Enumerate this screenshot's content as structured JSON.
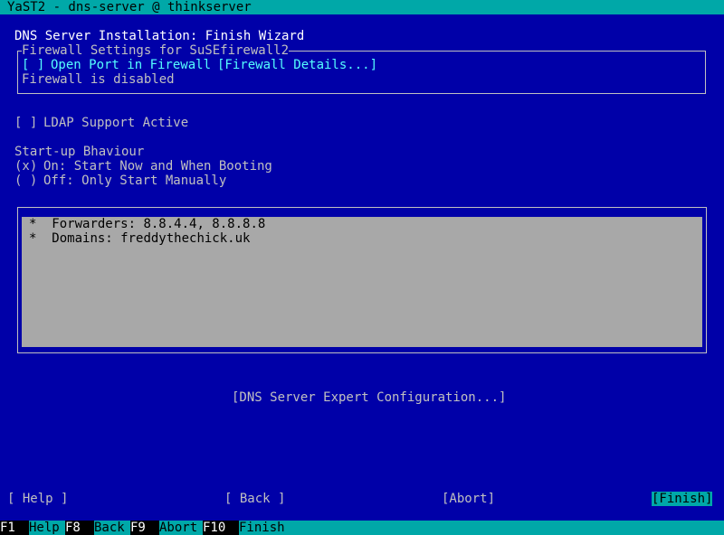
{
  "window": {
    "title": "YaST2 - dns-server @ thinkserver"
  },
  "dialog": {
    "heading": "DNS Server Installation: Finish Wizard"
  },
  "firewall": {
    "legend": "Firewall Settings for SuSEfirewall2",
    "open_port_checkbox": "[ ]",
    "open_port_label": "Open Port in Firewall",
    "details_button": "[Firewall Details...]",
    "status": "Firewall is disabled"
  },
  "ldap": {
    "checkbox": "[ ]",
    "label": "LDAP Support Active"
  },
  "startup": {
    "heading": "Start-up Bhaviour",
    "options": [
      {
        "radio": "(x)",
        "label": "On: Start Now and When Booting"
      },
      {
        "radio": "( )",
        "label": "Off: Only Start Manually"
      }
    ]
  },
  "summary": {
    "items": [
      {
        "bullet": "*",
        "text": "Forwarders: 8.8.4.4, 8.8.8.8"
      },
      {
        "bullet": "*",
        "text": "Domains: freddythechick.uk"
      }
    ]
  },
  "expert_button": "[DNS Server Expert Configuration...]",
  "buttons": {
    "help": "[ Help ]",
    "back": "[ Back ]",
    "abort": "[Abort]",
    "finish": "[Finish]"
  },
  "fkeys": [
    {
      "key": "F1",
      "label": "Help"
    },
    {
      "key": "F8",
      "label": "Back"
    },
    {
      "key": "F9",
      "label": "Abort"
    },
    {
      "key": "F10",
      "label": "Finish"
    }
  ],
  "colors": {
    "background": "#0000a8",
    "accent": "#00a8a8",
    "text": "#c0c0c0",
    "highlight": "#ffff55",
    "focus": "#55ffff"
  }
}
